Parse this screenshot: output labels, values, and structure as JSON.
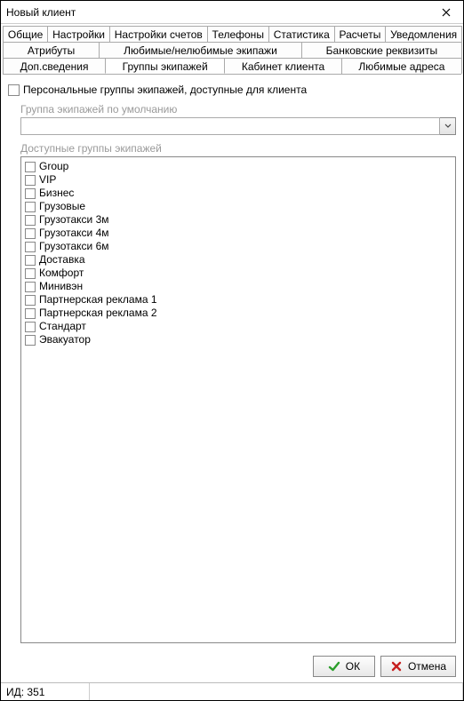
{
  "window": {
    "title": "Новый клиент"
  },
  "tabs": {
    "row1": [
      "Общие",
      "Настройки",
      "Настройки счетов",
      "Телефоны",
      "Статистика",
      "Расчеты",
      "Уведомления"
    ],
    "row2": [
      "Атрибуты",
      "Любимые/нелюбимые экипажи",
      "Банковские реквизиты"
    ],
    "row3": [
      "Доп.cведения",
      "Группы экипажей",
      "Кабинет клиента",
      "Любимые адреса"
    ],
    "active": "Группы экипажей"
  },
  "main": {
    "personal_groups_label": "Персональные группы экипажей, доступные для клиента",
    "default_group_label": "Группа экипажей по умолчанию",
    "default_group_value": "",
    "available_groups_label": "Доступные группы экипажей",
    "groups": [
      "Group",
      "VIP",
      "Бизнес",
      "Грузовые",
      "Грузотакси 3м",
      "Грузотакси 4м",
      "Грузотакси 6м",
      "Доставка",
      "Комфорт",
      "Минивэн",
      "Партнерская реклама 1",
      "Партнерская реклама 2",
      "Стандарт",
      "Эвакуатор"
    ]
  },
  "buttons": {
    "ok": "ОК",
    "cancel": "Отмена"
  },
  "status": {
    "id_label": "ИД: 351"
  }
}
